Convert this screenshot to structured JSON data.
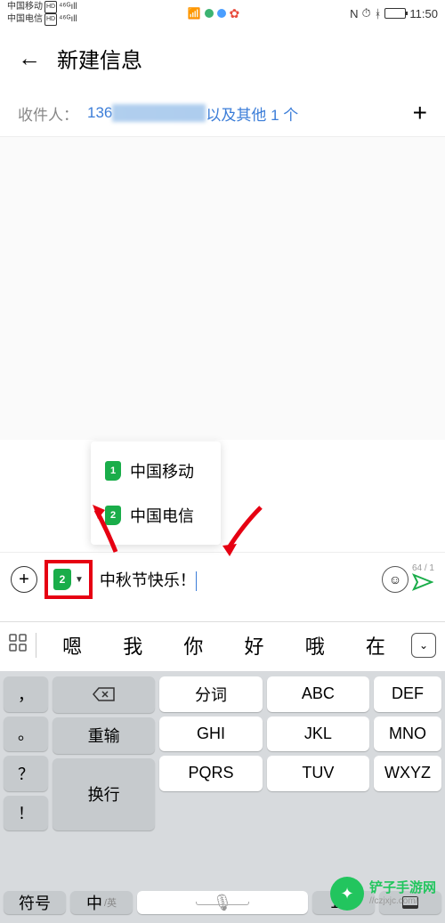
{
  "status_bar": {
    "carrier1": "中国移动",
    "carrier2": "中国电信",
    "hd": "HD",
    "sig": "⁴⁶ᴳıll",
    "nfc": "N",
    "alarm": "⏰",
    "bt": "*",
    "time": "11:50"
  },
  "header": {
    "back": "←",
    "title": "新建信息"
  },
  "recipients": {
    "label": "收件人：",
    "phone": "136",
    "more": "以及其他 1 个",
    "add": "+"
  },
  "sim_popup": {
    "items": [
      {
        "num": "1",
        "name": "中国移动"
      },
      {
        "num": "2",
        "name": "中国电信"
      }
    ]
  },
  "input": {
    "plus": "+",
    "selected_sim": "2",
    "dropdown": "▼",
    "text": "中秋节快乐！",
    "counter": "64 / 1"
  },
  "candidates": {
    "apps": "☰",
    "items": [
      "嗯",
      "我",
      "你",
      "好",
      "哦",
      "在"
    ],
    "expand": "⌄"
  },
  "keyboard": {
    "punct": [
      "，",
      "。",
      "？",
      "！"
    ],
    "grid": [
      [
        "分词",
        "ABC",
        "DEF"
      ],
      [
        "GHI",
        "JKL",
        "MNO"
      ],
      [
        "PQRS",
        "TUV",
        "WXYZ"
      ]
    ],
    "right": {
      "backspace": "⌫",
      "reinput": "重输",
      "enter": "换行"
    },
    "bottom": {
      "symbol": "符号",
      "lang": "中",
      "lang_sub": "/英",
      "mic": "🎤",
      "num": "123"
    }
  },
  "watermark": {
    "title": "铲子手游网",
    "url": "//czjxjc.com/"
  }
}
